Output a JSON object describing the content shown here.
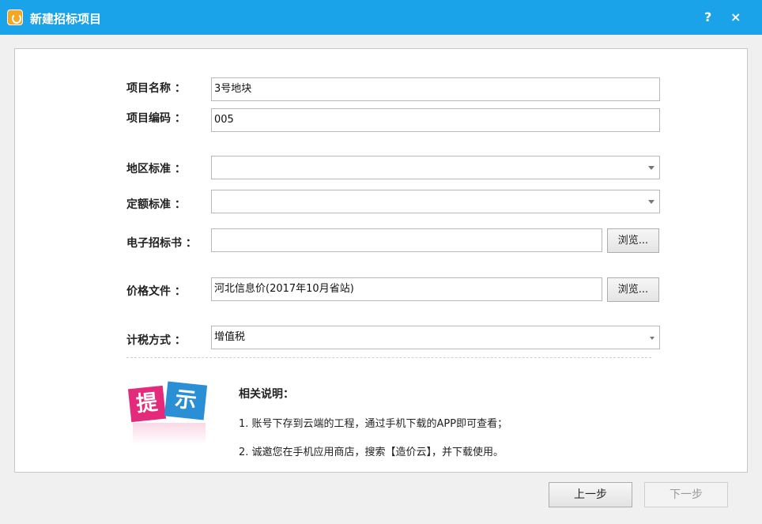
{
  "window": {
    "title": "新建招标项目",
    "help_label": "?",
    "close_label": "×"
  },
  "form": {
    "project_name": {
      "label": "项目名称 ：",
      "value": "3号地块"
    },
    "project_code": {
      "label": "项目编码 ：",
      "value": "005"
    },
    "region_standard": {
      "label": "地区标准 ：",
      "value": ""
    },
    "quota_standard": {
      "label": "定额标准 ：",
      "value": ""
    },
    "tender_doc": {
      "label": "电子招标书 ：",
      "value": "",
      "browse_label": "浏览..."
    },
    "price_file": {
      "label": "价格文件 ：",
      "value": "河北信息价(2017年10月省站)",
      "browse_label": "浏览..."
    },
    "tax_method": {
      "label": "计税方式 ：",
      "value": "增值税"
    }
  },
  "tip": {
    "logo_text_1": "提",
    "logo_text_2": "示",
    "title": "相关说明：",
    "items": [
      "1.  账号下存到云端的工程，通过手机下载的APP即可查看；",
      "2.  诚邀您在手机应用商店，搜索【造价云】，并下载使用。"
    ]
  },
  "footer": {
    "prev_label": "上一步",
    "next_label": "下一步"
  },
  "colors": {
    "titlebar": "#1aa3e8",
    "logo_pink": "#e42a7b",
    "logo_blue": "#2b8fd6"
  }
}
